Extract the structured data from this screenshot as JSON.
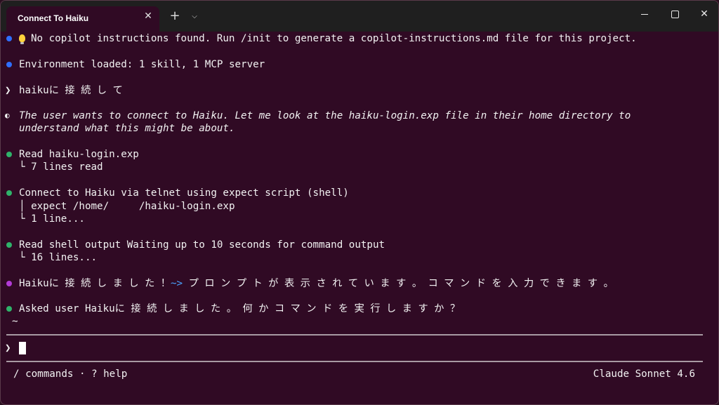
{
  "window": {
    "tab_title": "Connect To Haiku",
    "tab_close": "✕",
    "new_tab": "+",
    "tab_dropdown": "⌵",
    "close": "✕"
  },
  "terminal": {
    "notice_text": "No copilot instructions found. Run /init to generate a copilot-instructions.md file for this project.",
    "environment_text": "Environment loaded: 1 skill, 1 MCP server",
    "prompt_symbol": "❯",
    "user_message": "haikuに 接 続 し て",
    "thinking_symbol": "◐",
    "thinking_line1": "The user wants to connect to Haiku. Let me look at the haiku-login.exp file in their home directory to",
    "thinking_line2": "understand what this might be about.",
    "tool1_title": "Read haiku-login.exp",
    "tool1_result": "└ 7 lines read",
    "tool2_title": "Connect to Haiku via telnet using expect script (shell)",
    "tool2_command": "│ expect /home/     /haiku-login.exp",
    "tool2_result": "└ 1 line...",
    "tool3_title": "Read shell output Waiting up to 10 seconds for command output",
    "tool3_result": "└ 16 lines...",
    "assistant_prefix": "Haikuに 接 続 し ま し た ！",
    "assistant_accent": "~>",
    "assistant_suffix": " プ ロ ン プ ト が 表 示 さ れ て い ま す 。 コ マ ン ド を 入 力 で き ま す 。",
    "asked_user": "Asked user Haikuに 接 続 し ま し た 。 何 か コ マ ン ド を 実 行 し ま す か ？",
    "tilde": "~",
    "input_prompt": "❯"
  },
  "footer": {
    "hints": "/ commands · ? help",
    "model": "Claude Sonnet 4.6"
  },
  "colors": {
    "background": "#300a24",
    "bullet_blue": "#2f6fff",
    "bullet_green": "#2fb36a",
    "bullet_purple": "#b23bd6",
    "accent": "#4aa3ff"
  }
}
